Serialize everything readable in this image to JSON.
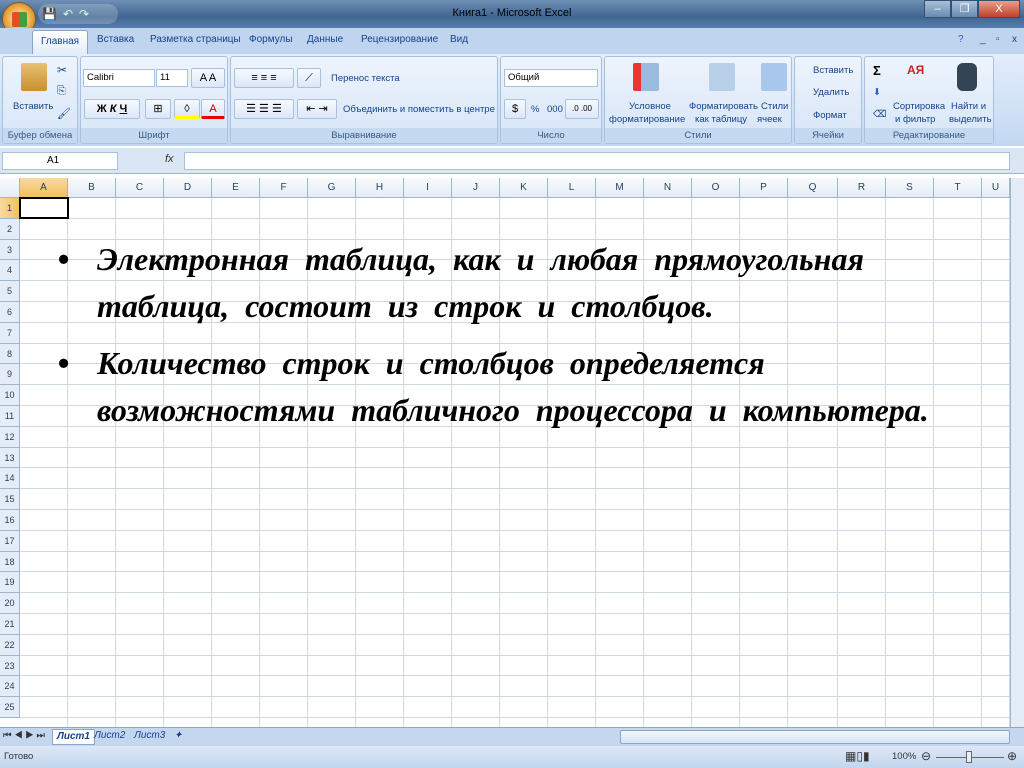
{
  "window": {
    "title": "Книга1 - Microsoft Excel",
    "minimize": "–",
    "restore": "❐",
    "close": "X"
  },
  "tabs": [
    "Главная",
    "Вставка",
    "Разметка страницы",
    "Формулы",
    "Данные",
    "Рецензирование",
    "Вид"
  ],
  "ribbon": {
    "clipboard": {
      "paste": "Вставить",
      "label": "Буфер обмена"
    },
    "font": {
      "name": "Calibri",
      "size": "11",
      "bold": "Ж",
      "italic": "К",
      "underline": "Ч",
      "label": "Шрифт"
    },
    "alignment": {
      "wrap": "Перенос текста",
      "merge": "Объединить и поместить в центре",
      "label": "Выравнивание"
    },
    "number": {
      "format": "Общий",
      "percent": "%",
      "thousands": "000",
      "label": "Число"
    },
    "styles": {
      "conditional": [
        "Условное",
        "форматирование"
      ],
      "as_table": [
        "Форматировать",
        "как таблицу"
      ],
      "cell_styles": [
        "Стили",
        "ячеек"
      ],
      "label": "Стили"
    },
    "cells": {
      "insert": "Вставить",
      "delete": "Удалить",
      "format": "Формат",
      "label": "Ячейки"
    },
    "editing": {
      "sum": "Σ",
      "sort": [
        "Сортировка",
        "и фильтр"
      ],
      "find": [
        "Найти и",
        "выделить"
      ],
      "label": "Редактирование"
    }
  },
  "formula_bar": {
    "name_box": "A1",
    "fx": "fx",
    "value": ""
  },
  "columns": [
    "A",
    "B",
    "C",
    "D",
    "E",
    "F",
    "G",
    "H",
    "I",
    "J",
    "K",
    "L",
    "M",
    "N",
    "O",
    "P",
    "Q",
    "R",
    "S",
    "T",
    "U"
  ],
  "rows": [
    "1",
    "2",
    "3",
    "4",
    "5",
    "6",
    "7",
    "8",
    "9",
    "10",
    "11",
    "12",
    "13",
    "14",
    "15",
    "16",
    "17",
    "18",
    "19",
    "20",
    "21",
    "22",
    "23",
    "24",
    "25"
  ],
  "slide_text": [
    "Электронная  таблица, как  и  любая прямоугольная  таблица, состоит из строк и столбцов.",
    "Количество строк и столбцов определяется возможностями табличного процессора и компьютера."
  ],
  "bullet": "•",
  "sheets": [
    "Лист1",
    "Лист2",
    "Лист3"
  ],
  "status": {
    "ready": "Готово",
    "zoom": "100%"
  }
}
